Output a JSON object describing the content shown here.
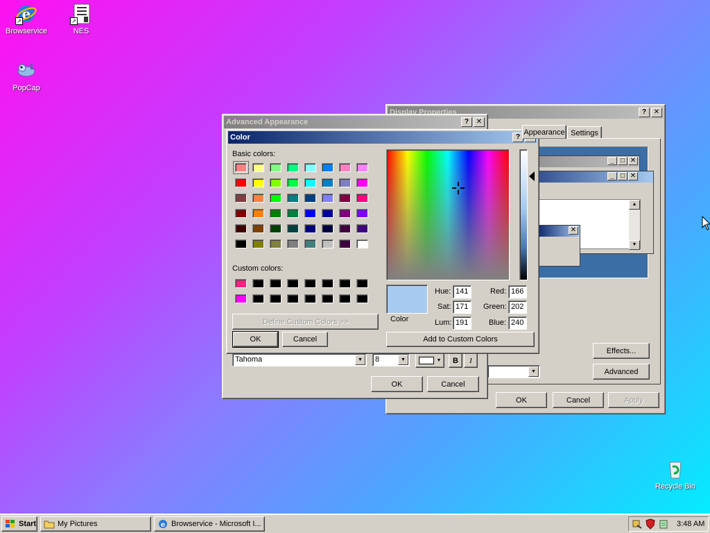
{
  "desktop": {
    "icons": [
      {
        "label": "Browservice"
      },
      {
        "label": "NES"
      },
      {
        "label": "PopCap"
      },
      {
        "label": "Recycle Bin"
      }
    ]
  },
  "display_properties": {
    "title": "Display Properties",
    "tabs": [
      "Appearance",
      "Settings"
    ],
    "buttons": {
      "effects": "Effects...",
      "advanced": "Advanced",
      "ok": "OK",
      "cancel": "Cancel",
      "apply": "Apply"
    }
  },
  "advanced_appearance": {
    "title": "Advanced Appearance",
    "font_value": "Tahoma",
    "size_value": "8",
    "bold": "B",
    "italic": "I",
    "buttons": {
      "ok": "OK",
      "cancel": "Cancel"
    }
  },
  "color_dialog": {
    "title": "Color",
    "basic_colors_label": "Basic colors:",
    "custom_colors_label": "Custom colors:",
    "basic_colors": [
      "#ff8080",
      "#ffff80",
      "#80ff80",
      "#00ff80",
      "#80ffff",
      "#0080ff",
      "#ff80c0",
      "#ff80ff",
      "#ff0000",
      "#ffff00",
      "#80ff00",
      "#00ff40",
      "#00ffff",
      "#0080c0",
      "#8080c0",
      "#ff00ff",
      "#804040",
      "#ff8040",
      "#00ff00",
      "#008080",
      "#004080",
      "#8080ff",
      "#800040",
      "#ff0080",
      "#800000",
      "#ff8000",
      "#008000",
      "#008040",
      "#0000ff",
      "#0000a0",
      "#800080",
      "#8000ff",
      "#400000",
      "#804000",
      "#004000",
      "#004040",
      "#000080",
      "#000040",
      "#400040",
      "#400080",
      "#000000",
      "#808000",
      "#808040",
      "#808080",
      "#408080",
      "#c0c0c0",
      "#400040",
      "#ffffff"
    ],
    "custom_colors": [
      "#ff2080",
      "#000000",
      "#000000",
      "#000000",
      "#000000",
      "#000000",
      "#000000",
      "#000000",
      "#ff00ff",
      "#000000",
      "#000000",
      "#000000",
      "#000000",
      "#000000",
      "#000000",
      "#000000"
    ],
    "define_custom_label": "Define Custom Colors >>",
    "ok_label": "OK",
    "cancel_label": "Cancel",
    "color_solid_label": "Color",
    "selected_color": "#a6caf0",
    "fields": {
      "hue_label": "Hue:",
      "hue": "141",
      "sat_label": "Sat:",
      "sat": "171",
      "lum_label": "Lum:",
      "lum": "191",
      "red_label": "Red:",
      "red": "166",
      "green_label": "Green:",
      "green": "202",
      "blue_label": "Blue:",
      "blue": "240"
    },
    "add_custom_label": "Add to Custom Colors"
  },
  "taskbar": {
    "start_label": "Start",
    "tasks": [
      {
        "label": "My Pictures"
      },
      {
        "label": "Browservice - Microsoft I..."
      }
    ],
    "clock": "3:48 AM"
  }
}
